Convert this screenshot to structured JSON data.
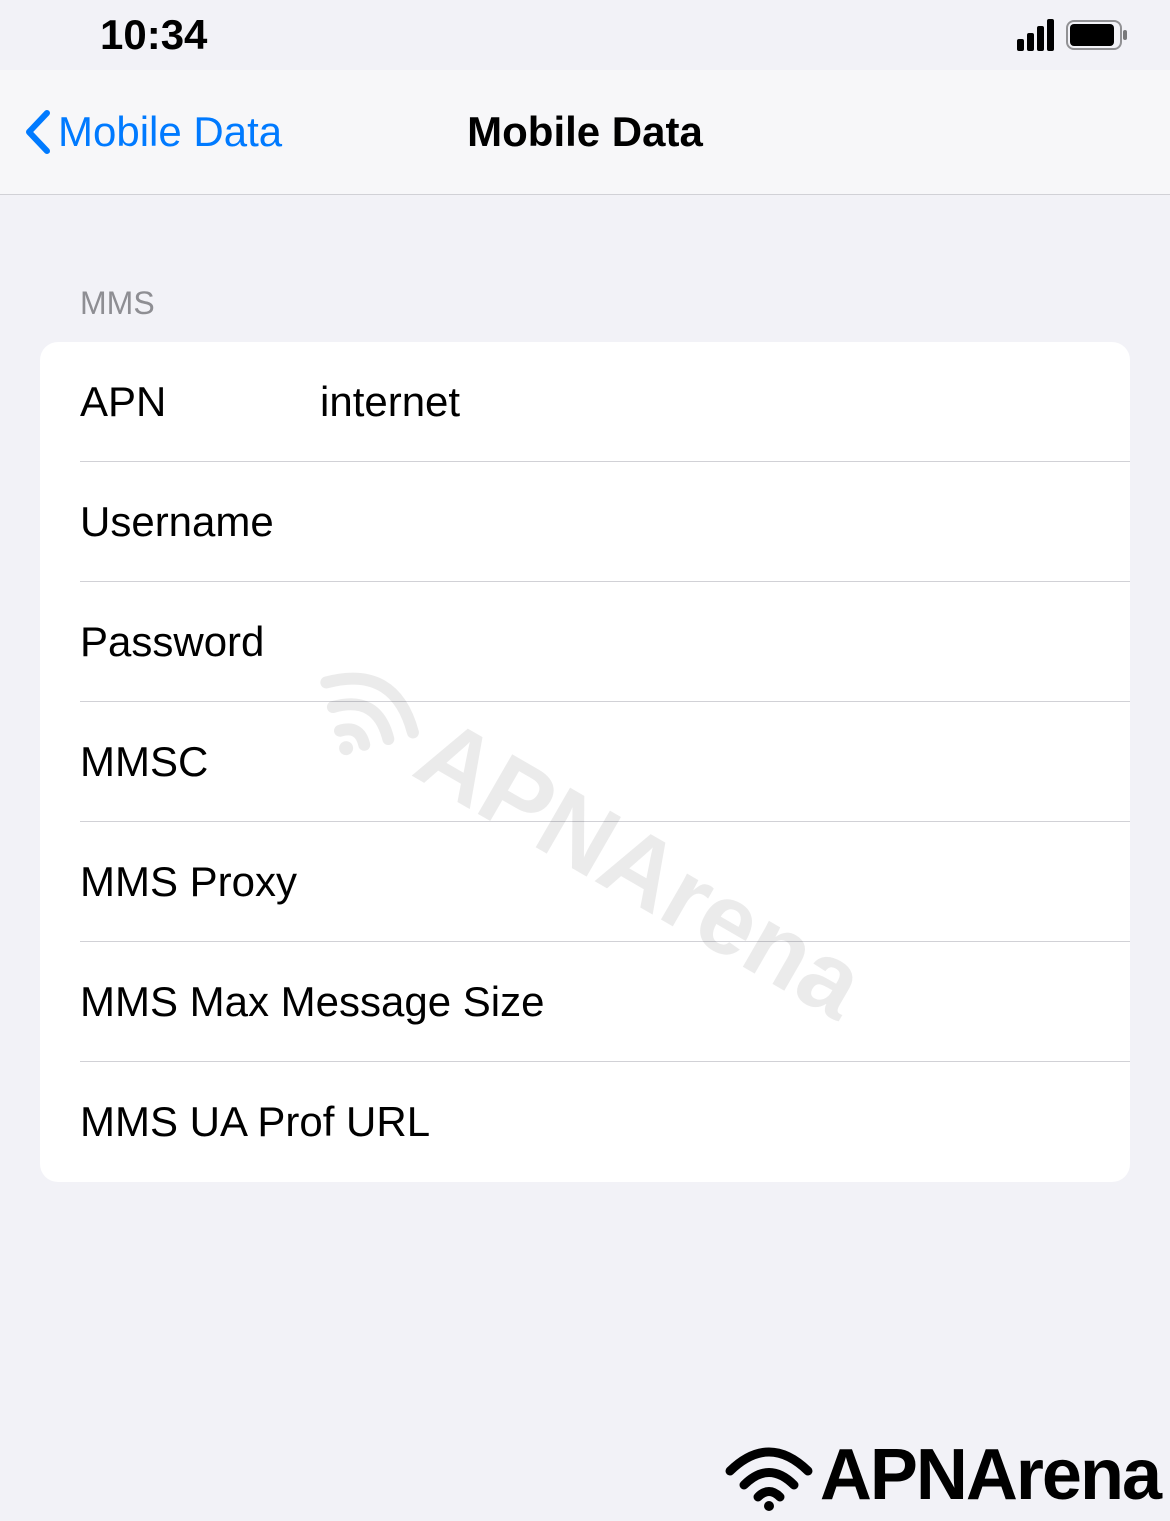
{
  "status": {
    "time": "10:34"
  },
  "nav": {
    "back_label": "Mobile Data",
    "title": "Mobile Data"
  },
  "section": {
    "header": "MMS"
  },
  "fields": {
    "apn_label": "APN",
    "apn_value": "internet",
    "username_label": "Username",
    "username_value": "",
    "password_label": "Password",
    "password_value": "",
    "mmsc_label": "MMSC",
    "mmsc_value": "",
    "mms_proxy_label": "MMS Proxy",
    "mms_proxy_value": "",
    "mms_max_label": "MMS Max Message Size",
    "mms_max_value": "",
    "mms_ua_label": "MMS UA Prof URL",
    "mms_ua_value": ""
  },
  "watermark": {
    "text": "APNArena"
  },
  "brand": {
    "text": "APNArena"
  }
}
